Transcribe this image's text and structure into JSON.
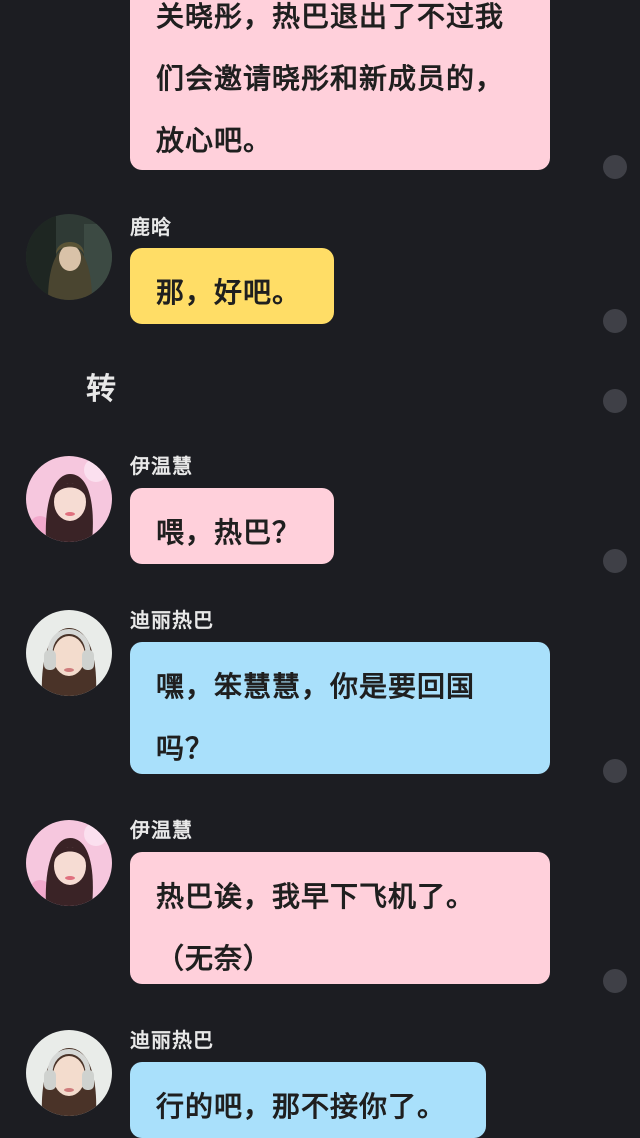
{
  "messages": [
    {
      "text": "关晓彤，热巴退出了不过我\n们会邀请晓彤和新成员的，\n放心吧。"
    },
    {
      "sender": "鹿晗",
      "text": "那，好吧。"
    },
    {
      "sender": "伊温慧",
      "text": "喂，热巴？"
    },
    {
      "sender": "迪丽热巴",
      "text": "嘿，笨慧慧，你是要回国\n吗？"
    },
    {
      "sender": "伊温慧",
      "text": "热巴诶，我早下飞机了。\n（无奈）"
    },
    {
      "sender": "迪丽热巴",
      "text": "行的吧，那不接你了。"
    }
  ],
  "narration": "转",
  "icons": {
    "avatar_luhan": "avatar-photo-hooded-man",
    "avatar_yiwenhui": "avatar-photo-girl-pink",
    "avatar_dilireba": "avatar-photo-woman-headphones",
    "status_dot": "circle-dot-icon"
  },
  "colors": {
    "background": "#1c1d22",
    "bubble_pink": "#ffd0db",
    "bubble_yellow": "#ffdd66",
    "bubble_blue": "#a9e0fb"
  }
}
